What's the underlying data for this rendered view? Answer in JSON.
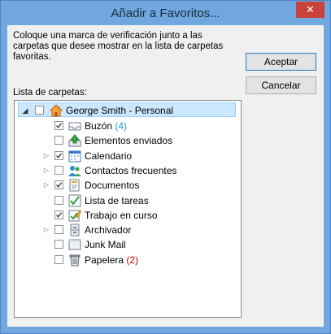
{
  "window": {
    "title": "Añadir a Favoritos...",
    "close_glyph": "✕"
  },
  "instructions": "Coloque una marca de verificación junto a las carpetas que desee mostrar en la lista de carpetas favoritas.",
  "list_label": "Lista de carpetas:",
  "buttons": {
    "ok": "Aceptar",
    "cancel": "Cancelar"
  },
  "tree": {
    "root": {
      "label": "George Smith - Personal",
      "expanded": true,
      "checked": false,
      "icon": "home-icon"
    },
    "items": [
      {
        "label": "Buzón",
        "count": "(4)",
        "count_color": "#1e9bd7",
        "checked": true,
        "expander": false,
        "icon": "inbox-icon"
      },
      {
        "label": "Elementos enviados",
        "count": "",
        "checked": false,
        "expander": false,
        "icon": "sent-items-icon"
      },
      {
        "label": "Calendario",
        "count": "",
        "checked": true,
        "expander": true,
        "icon": "calendar-icon"
      },
      {
        "label": "Contactos frecuentes",
        "count": "",
        "checked": false,
        "expander": true,
        "icon": "contacts-icon"
      },
      {
        "label": "Documentos",
        "count": "",
        "checked": true,
        "expander": true,
        "icon": "documents-icon"
      },
      {
        "label": "Lista de tareas",
        "count": "",
        "checked": false,
        "expander": false,
        "icon": "tasks-icon"
      },
      {
        "label": "Trabajo en curso",
        "count": "",
        "checked": true,
        "expander": false,
        "icon": "work-in-progress-icon"
      },
      {
        "label": "Archivador",
        "count": "",
        "checked": false,
        "expander": true,
        "icon": "archive-icon"
      },
      {
        "label": "Junk Mail",
        "count": "",
        "checked": false,
        "expander": false,
        "icon": "junk-mail-icon"
      },
      {
        "label": "Papelera",
        "count": "(2)",
        "count_color": "#c00000",
        "checked": false,
        "expander": false,
        "icon": "trash-icon"
      }
    ]
  }
}
